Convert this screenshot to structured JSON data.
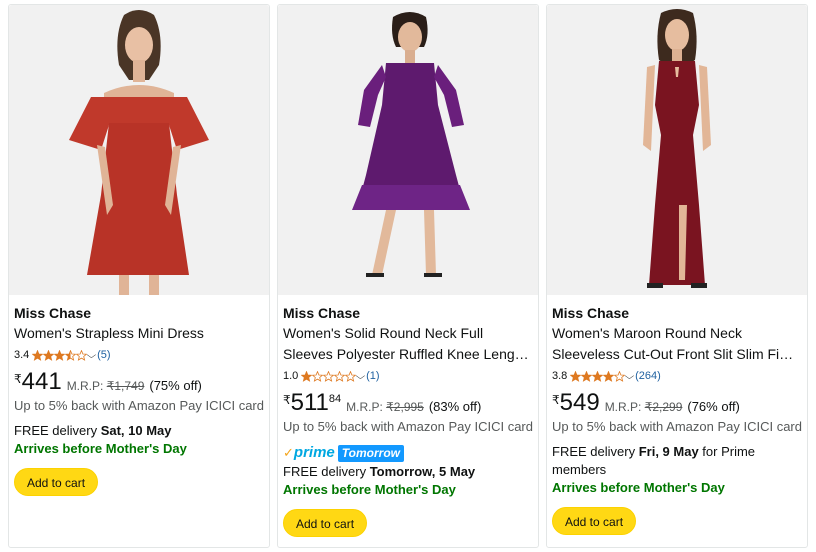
{
  "colors": {
    "accent_green": "#007600",
    "link_blue": "#2162a1",
    "star": "#de7921",
    "button": "#ffd814",
    "prime_blue": "#00a8e1"
  },
  "products": [
    {
      "image_icon": "red-off-shoulder-dress-photo",
      "brand": "Miss Chase",
      "title_lines": [
        "Women's Strapless Mini Dress"
      ],
      "rating": "3.4",
      "stars": 3.5,
      "rating_count": "(5)",
      "currency": "₹",
      "price_whole": "441",
      "price_fraction": "",
      "mrp_label": "M.R.P:",
      "mrp_value": "₹1,749",
      "discount": "(75% off)",
      "cashback": "Up to 5% back with Amazon Pay ICICI card",
      "delivery_prefix": "FREE delivery ",
      "delivery_date": "Sat, 10 May",
      "delivery_suffix": "",
      "arrives": "Arrives before Mother's Day",
      "add_to_cart": "Add to cart"
    },
    {
      "image_icon": "purple-ruffle-dress-photo",
      "brand": "Miss Chase",
      "title_lines": [
        "Women's Solid Round Neck Full",
        "Sleeves Polyester Ruffled Knee Leng…"
      ],
      "rating": "1.0",
      "stars": 1,
      "rating_count": "(1)",
      "currency": "₹",
      "price_whole": "511",
      "price_fraction": "84",
      "mrp_label": "M.R.P:",
      "mrp_value": "₹2,995",
      "discount": "(83% off)",
      "cashback": "Up to 5% back with Amazon Pay ICICI card",
      "prime_word": "prime",
      "prime_badge": "Tomorrow",
      "delivery_prefix": "FREE delivery ",
      "delivery_date": "Tomorrow, 5 May",
      "delivery_suffix": "",
      "arrives": "Arrives before Mother's Day",
      "add_to_cart": "Add to cart"
    },
    {
      "image_icon": "maroon-maxi-dress-photo",
      "brand": "Miss Chase",
      "title_lines": [
        "Women's Maroon Round Neck",
        "Sleeveless Cut-Out Front Slit Slim Fi…"
      ],
      "rating": "3.8",
      "stars": 4,
      "rating_count": "(264)",
      "currency": "₹",
      "price_whole": "549",
      "price_fraction": "",
      "mrp_label": "M.R.P:",
      "mrp_value": "₹2,299",
      "discount": "(76% off)",
      "cashback": "Up to 5% back with Amazon Pay ICICI card",
      "delivery_prefix": "FREE delivery ",
      "delivery_date": "Fri, 9 May",
      "delivery_suffix": " for Prime members",
      "arrives": "Arrives before Mother's Day",
      "add_to_cart": "Add to cart"
    }
  ]
}
